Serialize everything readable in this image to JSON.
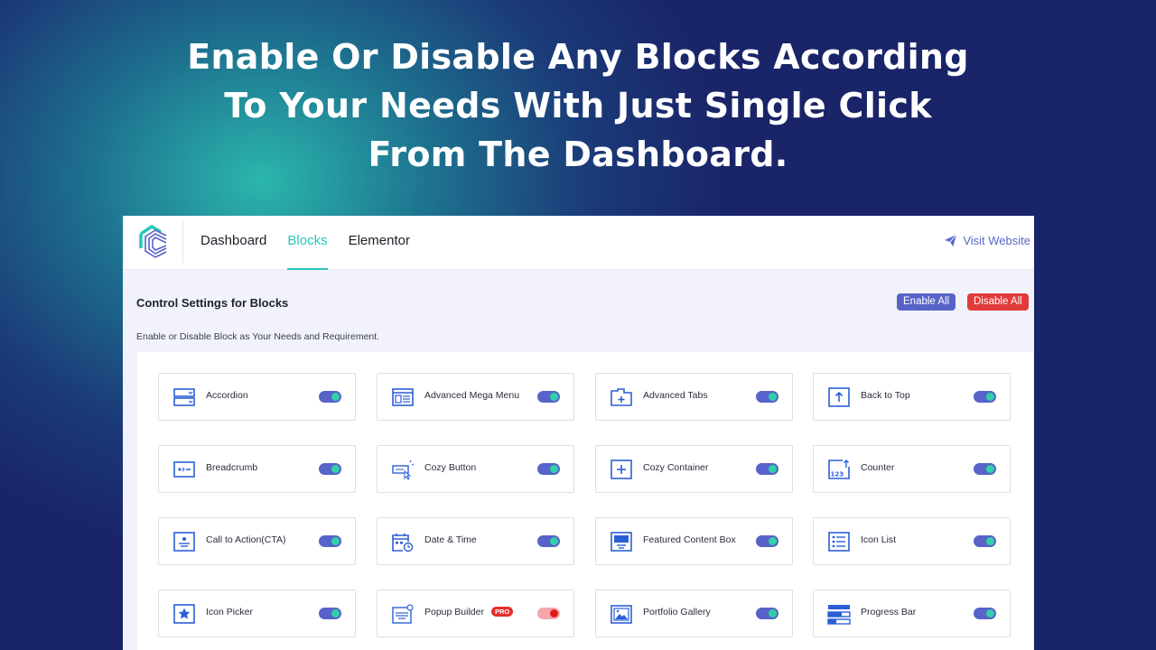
{
  "headline": {
    "line1": "Enable Or Disable Any Blocks According",
    "line2": "To Your Needs With Just Single Click",
    "line3": "From The Dashboard."
  },
  "nav": {
    "items": [
      {
        "label": "Dashboard",
        "active": false
      },
      {
        "label": "Blocks",
        "active": true
      },
      {
        "label": "Elementor",
        "active": false
      }
    ],
    "visit_label": "Visit Website"
  },
  "settings": {
    "title": "Control Settings for Blocks",
    "subtitle": "Enable or Disable Block as Your Needs and Requirement.",
    "enable_all_label": "Enable All",
    "disable_all_label": "Disable All"
  },
  "colors": {
    "accent_teal": "#29c6bb",
    "primary_blue": "#5863c9",
    "danger_red": "#e23b3b",
    "icon_blue": "#2c5fd7"
  },
  "blocks": [
    {
      "label": "Accordion",
      "icon": "accordion-icon",
      "enabled": true
    },
    {
      "label": "Advanced Mega Menu",
      "icon": "mega-menu-icon",
      "enabled": true
    },
    {
      "label": "Advanced Tabs",
      "icon": "tabs-icon",
      "enabled": true
    },
    {
      "label": "Back to Top",
      "icon": "arrow-up-icon",
      "enabled": true
    },
    {
      "label": "Breadcrumb",
      "icon": "breadcrumb-icon",
      "enabled": true
    },
    {
      "label": "Cozy Button",
      "icon": "cursor-button-icon",
      "enabled": true
    },
    {
      "label": "Cozy Container",
      "icon": "plus-box-icon",
      "enabled": true
    },
    {
      "label": "Counter",
      "icon": "counter-icon",
      "enabled": true
    },
    {
      "label": "Call to Action(CTA)",
      "icon": "cta-icon",
      "enabled": true
    },
    {
      "label": "Date & Time",
      "icon": "calendar-clock-icon",
      "enabled": true
    },
    {
      "label": "Featured Content Box",
      "icon": "featured-box-icon",
      "enabled": true
    },
    {
      "label": "Icon List",
      "icon": "list-icon",
      "enabled": true
    },
    {
      "label": "Icon Picker",
      "icon": "star-box-icon",
      "enabled": true
    },
    {
      "label": "Popup Builder",
      "icon": "popup-icon",
      "enabled": false,
      "badge": "PRO"
    },
    {
      "label": "Portfolio Gallery",
      "icon": "gallery-icon",
      "enabled": true
    },
    {
      "label": "Progress Bar",
      "icon": "progress-bar-icon",
      "enabled": true
    }
  ]
}
